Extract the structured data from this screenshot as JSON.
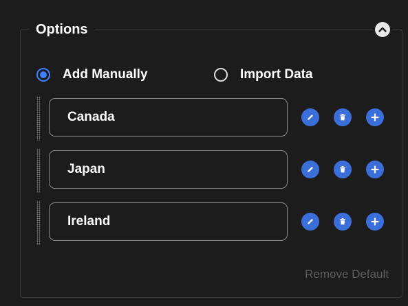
{
  "options": {
    "title": "Options",
    "source_modes": [
      {
        "label": "Add Manually",
        "selected": true
      },
      {
        "label": "Import Data",
        "selected": false
      }
    ],
    "items": [
      {
        "value": "Canada"
      },
      {
        "value": "Japan"
      },
      {
        "value": "Ireland"
      }
    ],
    "remove_default_label": "Remove Default"
  },
  "icons": {
    "collapse": "chevron-up-icon",
    "edit": "pencil-icon",
    "delete": "trash-icon",
    "add": "plus-icon",
    "drag": "drag-handle-icon"
  },
  "colors": {
    "accent": "#3b6ed8",
    "radio_selected": "#3f7fff",
    "background": "#1c1c1c",
    "muted_text": "#5d5d5d"
  }
}
